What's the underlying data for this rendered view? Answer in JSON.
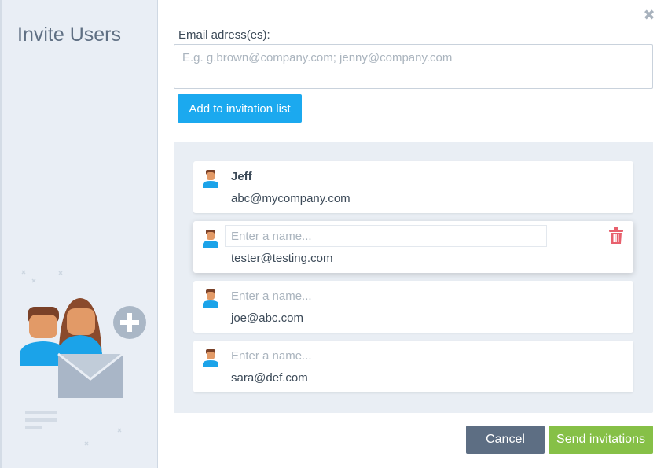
{
  "sidebar": {
    "title": "Invite Users"
  },
  "form": {
    "email_label": "Email adress(es):",
    "email_placeholder": "E.g. g.brown@company.com; jenny@company.com",
    "email_value": "",
    "add_button_label": "Add to invitation list"
  },
  "invitations": [
    {
      "name": "Jeff",
      "name_placeholder": "",
      "email": "abc@mycompany.com"
    },
    {
      "name": "",
      "name_placeholder": "Enter a name...",
      "email": "tester@testing.com"
    },
    {
      "name": "",
      "name_placeholder": "Enter a name...",
      "email": "joe@abc.com"
    },
    {
      "name": "",
      "name_placeholder": "Enter a name...",
      "email": "sara@def.com"
    }
  ],
  "footer": {
    "cancel_label": "Cancel",
    "send_label": "Send invitations"
  },
  "icons": {
    "close": "close-icon",
    "avatar": "user-avatar-icon",
    "trash": "trash-icon",
    "illustration": "invite-users-illustration"
  },
  "colors": {
    "primary": "#1ba9ef",
    "success": "#86c047",
    "secondary": "#5d6e83",
    "danger": "#e8606d",
    "sidebar_bg": "#e9eef5"
  }
}
